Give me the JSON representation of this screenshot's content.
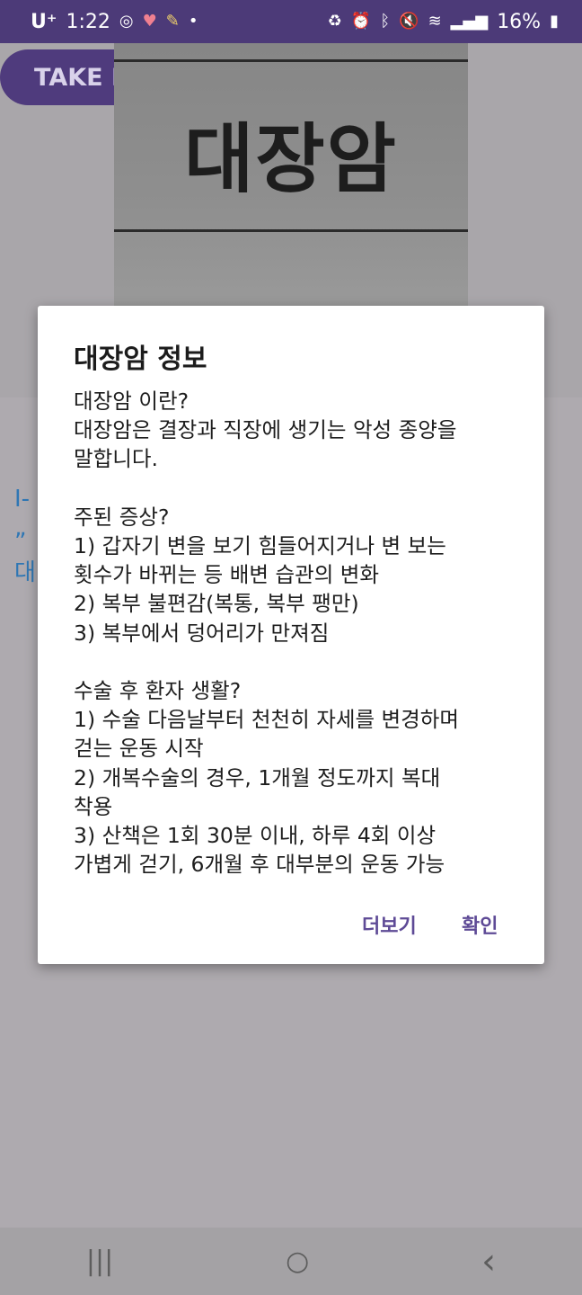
{
  "status_bar": {
    "carrier": "U⁺",
    "time": "1:22",
    "battery": "16%",
    "left_icons": [
      "sync-icon",
      "heart-icon",
      "pencil-icon",
      "dot-icon"
    ],
    "right_icons": [
      "recycle-icon",
      "alarm-icon",
      "bluetooth-icon",
      "mute-icon",
      "wifi-icon",
      "signal-icon",
      "battery-icon"
    ]
  },
  "app": {
    "take_button_label": "TAKE PHOTO",
    "photo_text": "대장암",
    "side_text_1": "I-",
    "side_text_2": "„",
    "side_text_3": "대"
  },
  "dialog": {
    "title": "대장암 정보",
    "body": "대장암 이란?\n대장암은 결장과 직장에 생기는 악성 종양을\n말합니다.\n\n주된 증상?\n1) 갑자기 변을 보기 힘들어지거나 변 보는\n횟수가 바뀌는 등 배변 습관의 변화\n2) 복부 불편감(복통, 복부 팽만)\n3) 복부에서 덩어리가 만져짐\n\n수술 후 환자 생활?\n1) 수술 다음날부터 천천히 자세를 변경하며\n걷는 운동 시작\n2) 개복수술의 경우, 1개월 정도까지 복대\n착용\n3) 산책은 1회 30분 이내, 하루 4회 이상\n가볍게 걷기, 6개월 후 대부분의 운동 가능",
    "more_button": "더보기",
    "ok_button": "확인"
  },
  "nav_bar": {
    "recents_icon": "|||",
    "home_icon": "○",
    "back_icon": "‹"
  },
  "colors": {
    "status_bar": "#4c3a78",
    "accent": "#5e4a96",
    "scrim": "#aeaaaf"
  }
}
